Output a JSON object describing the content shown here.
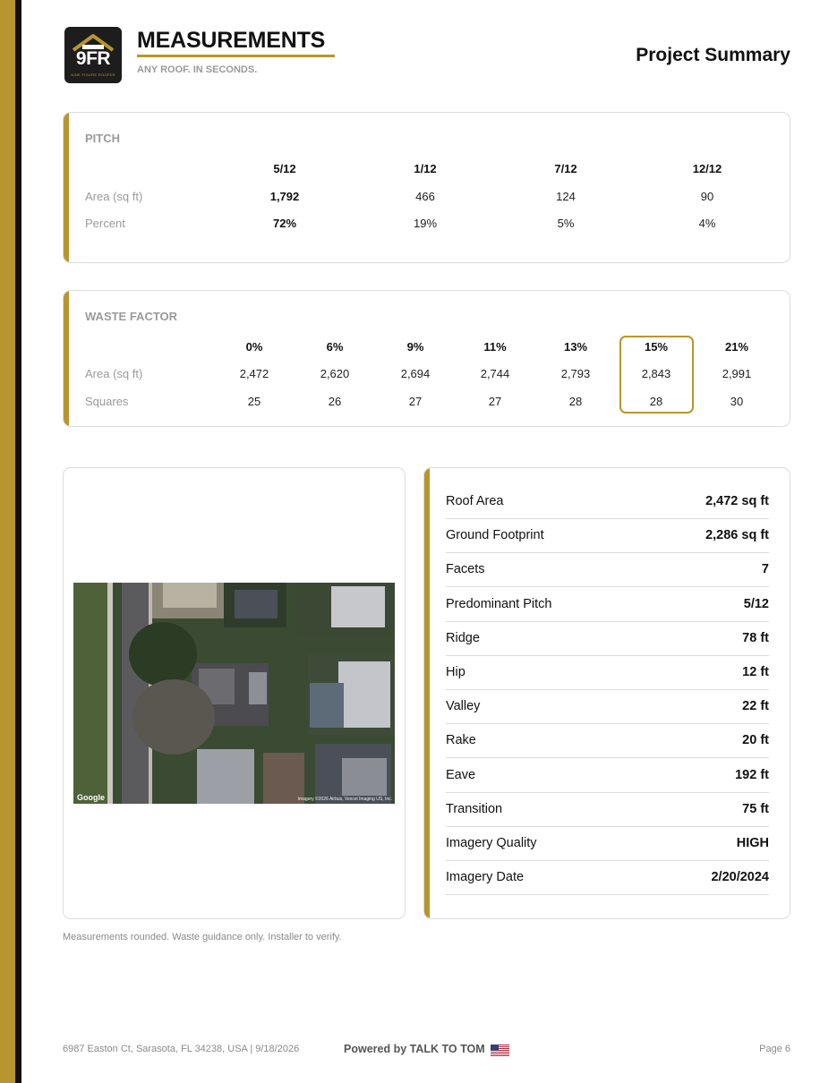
{
  "header": {
    "logo_text": "9FR",
    "logo_subtext": "NINE FIGURE ROOFER",
    "brand_title": "MEASUREMENTS",
    "tagline": "ANY ROOF. IN SECONDS.",
    "page_heading": "Project Summary"
  },
  "pitch": {
    "label": "PITCH",
    "row_labels": [
      "Area (sq ft)",
      "Percent"
    ],
    "columns": [
      {
        "pitch": "5/12",
        "area": "1,792",
        "percent": "72%",
        "bold": true
      },
      {
        "pitch": "1/12",
        "area": "466",
        "percent": "19%",
        "bold": false
      },
      {
        "pitch": "7/12",
        "area": "124",
        "percent": "5%",
        "bold": false
      },
      {
        "pitch": "12/12",
        "area": "90",
        "percent": "4%",
        "bold": false
      }
    ]
  },
  "waste": {
    "label": "WASTE FACTOR",
    "row_labels": [
      "Area (sq ft)",
      "Squares"
    ],
    "highlight_index": 5,
    "columns": [
      {
        "pct": "0%",
        "area": "2,472",
        "squares": "25"
      },
      {
        "pct": "6%",
        "area": "2,620",
        "squares": "26"
      },
      {
        "pct": "9%",
        "area": "2,694",
        "squares": "27"
      },
      {
        "pct": "11%",
        "area": "2,744",
        "squares": "27"
      },
      {
        "pct": "13%",
        "area": "2,793",
        "squares": "28"
      },
      {
        "pct": "15%",
        "area": "2,843",
        "squares": "28"
      },
      {
        "pct": "21%",
        "area": "2,991",
        "squares": "30"
      }
    ]
  },
  "aerial": {
    "google_mark": "Google",
    "credit": "Imagery ©2026 Airbus, Vexcel Imaging US, Inc."
  },
  "stats": [
    {
      "label": "Roof Area",
      "value": "2,472 sq ft"
    },
    {
      "label": "Ground Footprint",
      "value": "2,286 sq ft"
    },
    {
      "label": "Facets",
      "value": "7"
    },
    {
      "label": "Predominant Pitch",
      "value": "5/12"
    },
    {
      "label": "Ridge",
      "value": "78 ft"
    },
    {
      "label": "Hip",
      "value": "12 ft"
    },
    {
      "label": "Valley",
      "value": "22 ft"
    },
    {
      "label": "Rake",
      "value": "20 ft"
    },
    {
      "label": "Eave",
      "value": "192 ft"
    },
    {
      "label": "Transition",
      "value": "75 ft"
    },
    {
      "label": "Imagery Quality",
      "value": "HIGH"
    },
    {
      "label": "Imagery Date",
      "value": "2/20/2024"
    }
  ],
  "note": "Measurements rounded. Waste guidance only. Installer to verify.",
  "footer": {
    "address": "6987 Easton Ct, Sarasota, FL 34238, USA  |  9/18/2026",
    "powered_by": "Powered by TALK TO TOM",
    "page": "Page 6"
  },
  "colors": {
    "accent_gold": "#b8952e",
    "dark": "#111111",
    "muted_text": "#9a9a9a",
    "border": "#dcdcdc"
  }
}
